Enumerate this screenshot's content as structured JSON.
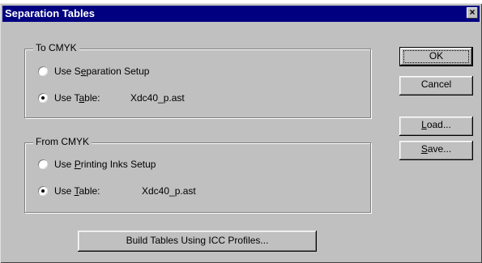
{
  "dialog": {
    "title": "Separation Tables",
    "close_glyph": "×"
  },
  "to_cmyk": {
    "label": "To CMYK",
    "option1": {
      "prefix": "Use S",
      "accel": "e",
      "suffix": "paration Setup"
    },
    "option2": {
      "prefix": "Use T",
      "accel": "a",
      "suffix": "ble:"
    },
    "table_value": "Xdc40_p.ast",
    "selected": "option2"
  },
  "from_cmyk": {
    "label": "From CMYK",
    "option1": {
      "prefix": "Use ",
      "accel": "P",
      "suffix": "rinting Inks Setup"
    },
    "option2": {
      "prefix": "Use ",
      "accel": "T",
      "suffix": "able:"
    },
    "table_value": "Xdc40_p.ast",
    "selected": "option2"
  },
  "buttons": {
    "ok": "OK",
    "cancel": "Cancel",
    "load": {
      "accel": "L",
      "rest": "oad..."
    },
    "save": {
      "accel": "S",
      "rest": "ave..."
    },
    "build": "Build Tables Using ICC Profiles..."
  }
}
